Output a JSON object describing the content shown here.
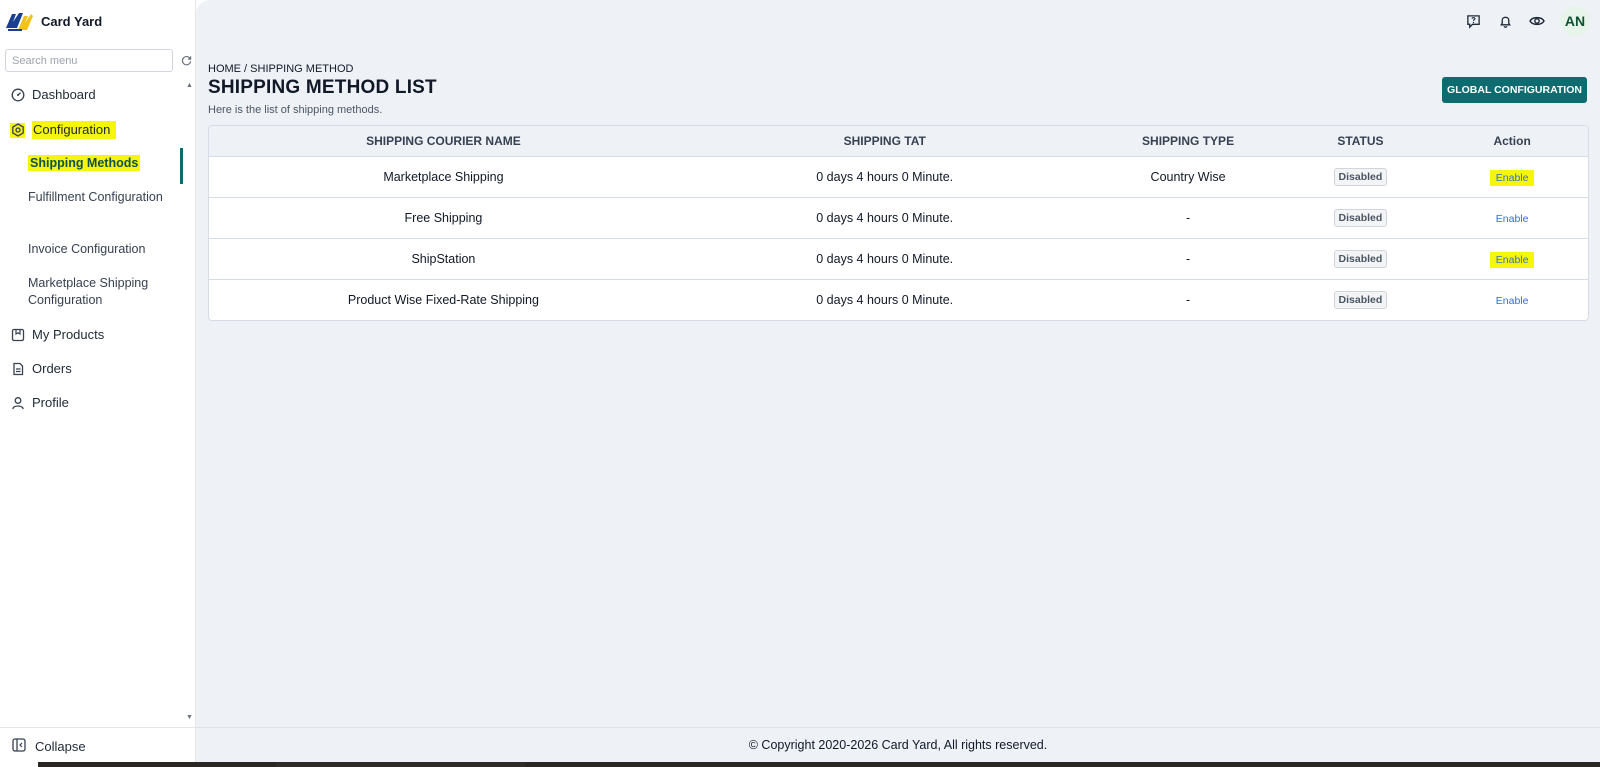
{
  "brand": {
    "name": "Card Yard"
  },
  "search": {
    "placeholder": "Search menu"
  },
  "sidebar": {
    "items": [
      {
        "label": "Dashboard",
        "icon": "dashboard-icon"
      },
      {
        "label": "Configuration",
        "icon": "settings-hex-icon"
      },
      {
        "label": "My Products",
        "icon": "products-icon"
      },
      {
        "label": "Orders",
        "icon": "orders-icon"
      },
      {
        "label": "Profile",
        "icon": "user-icon"
      }
    ],
    "sub_items": [
      {
        "label": "Shipping Methods"
      },
      {
        "label": "Fulfillment Configuration"
      },
      {
        "label": "Invoice Configuration"
      },
      {
        "label": "Marketplace Shipping Configuration"
      }
    ],
    "collapse_label": "Collapse"
  },
  "topbar": {
    "icons": [
      "help-chat-icon",
      "bell-icon",
      "eye-icon"
    ],
    "avatar_initials": "AN"
  },
  "page": {
    "breadcrumb": "HOME / SHIPPING METHOD",
    "title": "SHIPPING METHOD LIST",
    "subtitle": "Here is the list of shipping methods.",
    "global_button": "GLOBAL CONFIGURATION"
  },
  "table": {
    "headers": [
      "SHIPPING COURIER NAME",
      "SHIPPING TAT",
      "SHIPPING TYPE",
      "STATUS",
      "Action"
    ],
    "rows": [
      {
        "name": "Marketplace Shipping",
        "tat": "0 days 4 hours 0 Minute.",
        "type": "Country Wise",
        "status": "Disabled",
        "action": "Enable"
      },
      {
        "name": "Free Shipping",
        "tat": "0 days 4 hours 0 Minute.",
        "type": "-",
        "status": "Disabled",
        "action": "Enable"
      },
      {
        "name": "ShipStation",
        "tat": "0 days 4 hours 0 Minute.",
        "type": "-",
        "status": "Disabled",
        "action": "Enable"
      },
      {
        "name": "Product Wise Fixed-Rate Shipping",
        "tat": "0 days 4 hours 0 Minute.",
        "type": "-",
        "status": "Disabled",
        "action": "Enable"
      }
    ]
  },
  "footer": {
    "text": "© Copyright 2020-2026 Card Yard, All rights reserved."
  },
  "colors": {
    "accent": "#0e6b6f",
    "highlight": "#f6f60a",
    "link": "#2f6fd6",
    "background": "#eef2f7"
  }
}
